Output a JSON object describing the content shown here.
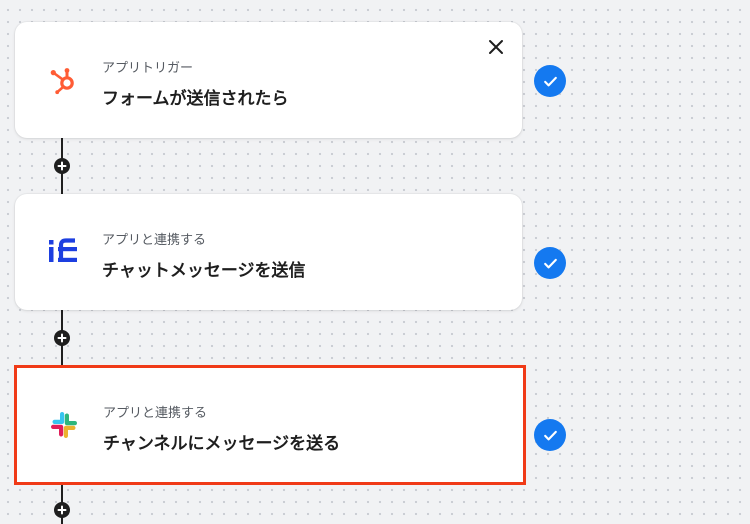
{
  "flow": {
    "steps": [
      {
        "subtitle": "アプリトリガー",
        "title": "フォームが送信されたら",
        "app_icon": "hubspot-icon",
        "status_icon": "check-icon",
        "has_close": true,
        "selected": false
      },
      {
        "subtitle": "アプリと連携する",
        "title": "チャットメッセージを送信",
        "app_icon": "if-logo-icon",
        "status_icon": "check-icon",
        "selected": false
      },
      {
        "subtitle": "アプリと連携する",
        "title": "チャンネルにメッセージを送る",
        "app_icon": "slack-icon",
        "status_icon": "check-icon",
        "selected": true
      }
    ]
  },
  "colors": {
    "canvas_bg": "#f1f2f4",
    "accent_blue": "#1479f0",
    "selected_border": "#f03a17",
    "hubspot_orange": "#ff5c35",
    "if_blue": "#1d3fe0",
    "slack_blue": "#36c5f0",
    "slack_green": "#2eb67d",
    "slack_yellow": "#ecb22e",
    "slack_red": "#e01e5a"
  }
}
